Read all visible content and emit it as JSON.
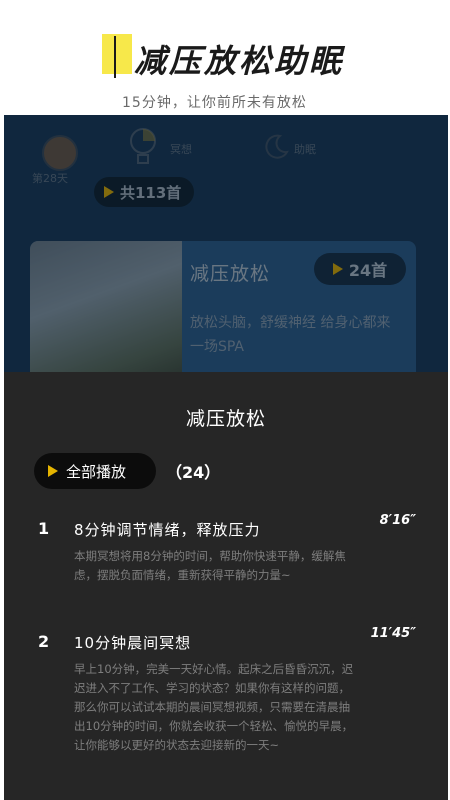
{
  "hero": {
    "title": "减压放松助眠",
    "subtitle": "15分钟，让你前所未有放松"
  },
  "screen": {
    "tabs": {
      "day_label": "第28天",
      "meditate_label": "冥想",
      "sleep_label": "助眠"
    },
    "total_label": "共113首",
    "card": {
      "title": "减压放松",
      "count_label": "24首",
      "desc": "放松头脑，舒缓神经 给身心都来一场SPA"
    }
  },
  "sheet": {
    "title": "减压放松",
    "play_all_label": "全部播放",
    "count": "（24）",
    "items": [
      {
        "num": "1",
        "title": "8分钟调节情绪，释放压力",
        "duration": "8′16″",
        "desc": "本期冥想将用8分钟的时间，帮助你快速平静，缓解焦虑，摆脱负面情绪，重新获得平静的力量~"
      },
      {
        "num": "2",
        "title": "10分钟晨间冥想",
        "duration": "11′45″",
        "desc": "早上10分钟，完美一天好心情。起床之后昏昏沉沉，迟迟进入不了工作、学习的状态？如果你有这样的问题，那么你可以试试本期的晨间冥想视频，只需要在清晨抽出10分钟的时间，你就会收获一个轻松、愉悦的早晨，让你能够以更好的状态去迎接新的一天~"
      }
    ]
  },
  "colors": {
    "accent": "#e5b400",
    "sheet_bg": "#262626",
    "highlight": "#f7e84a"
  }
}
